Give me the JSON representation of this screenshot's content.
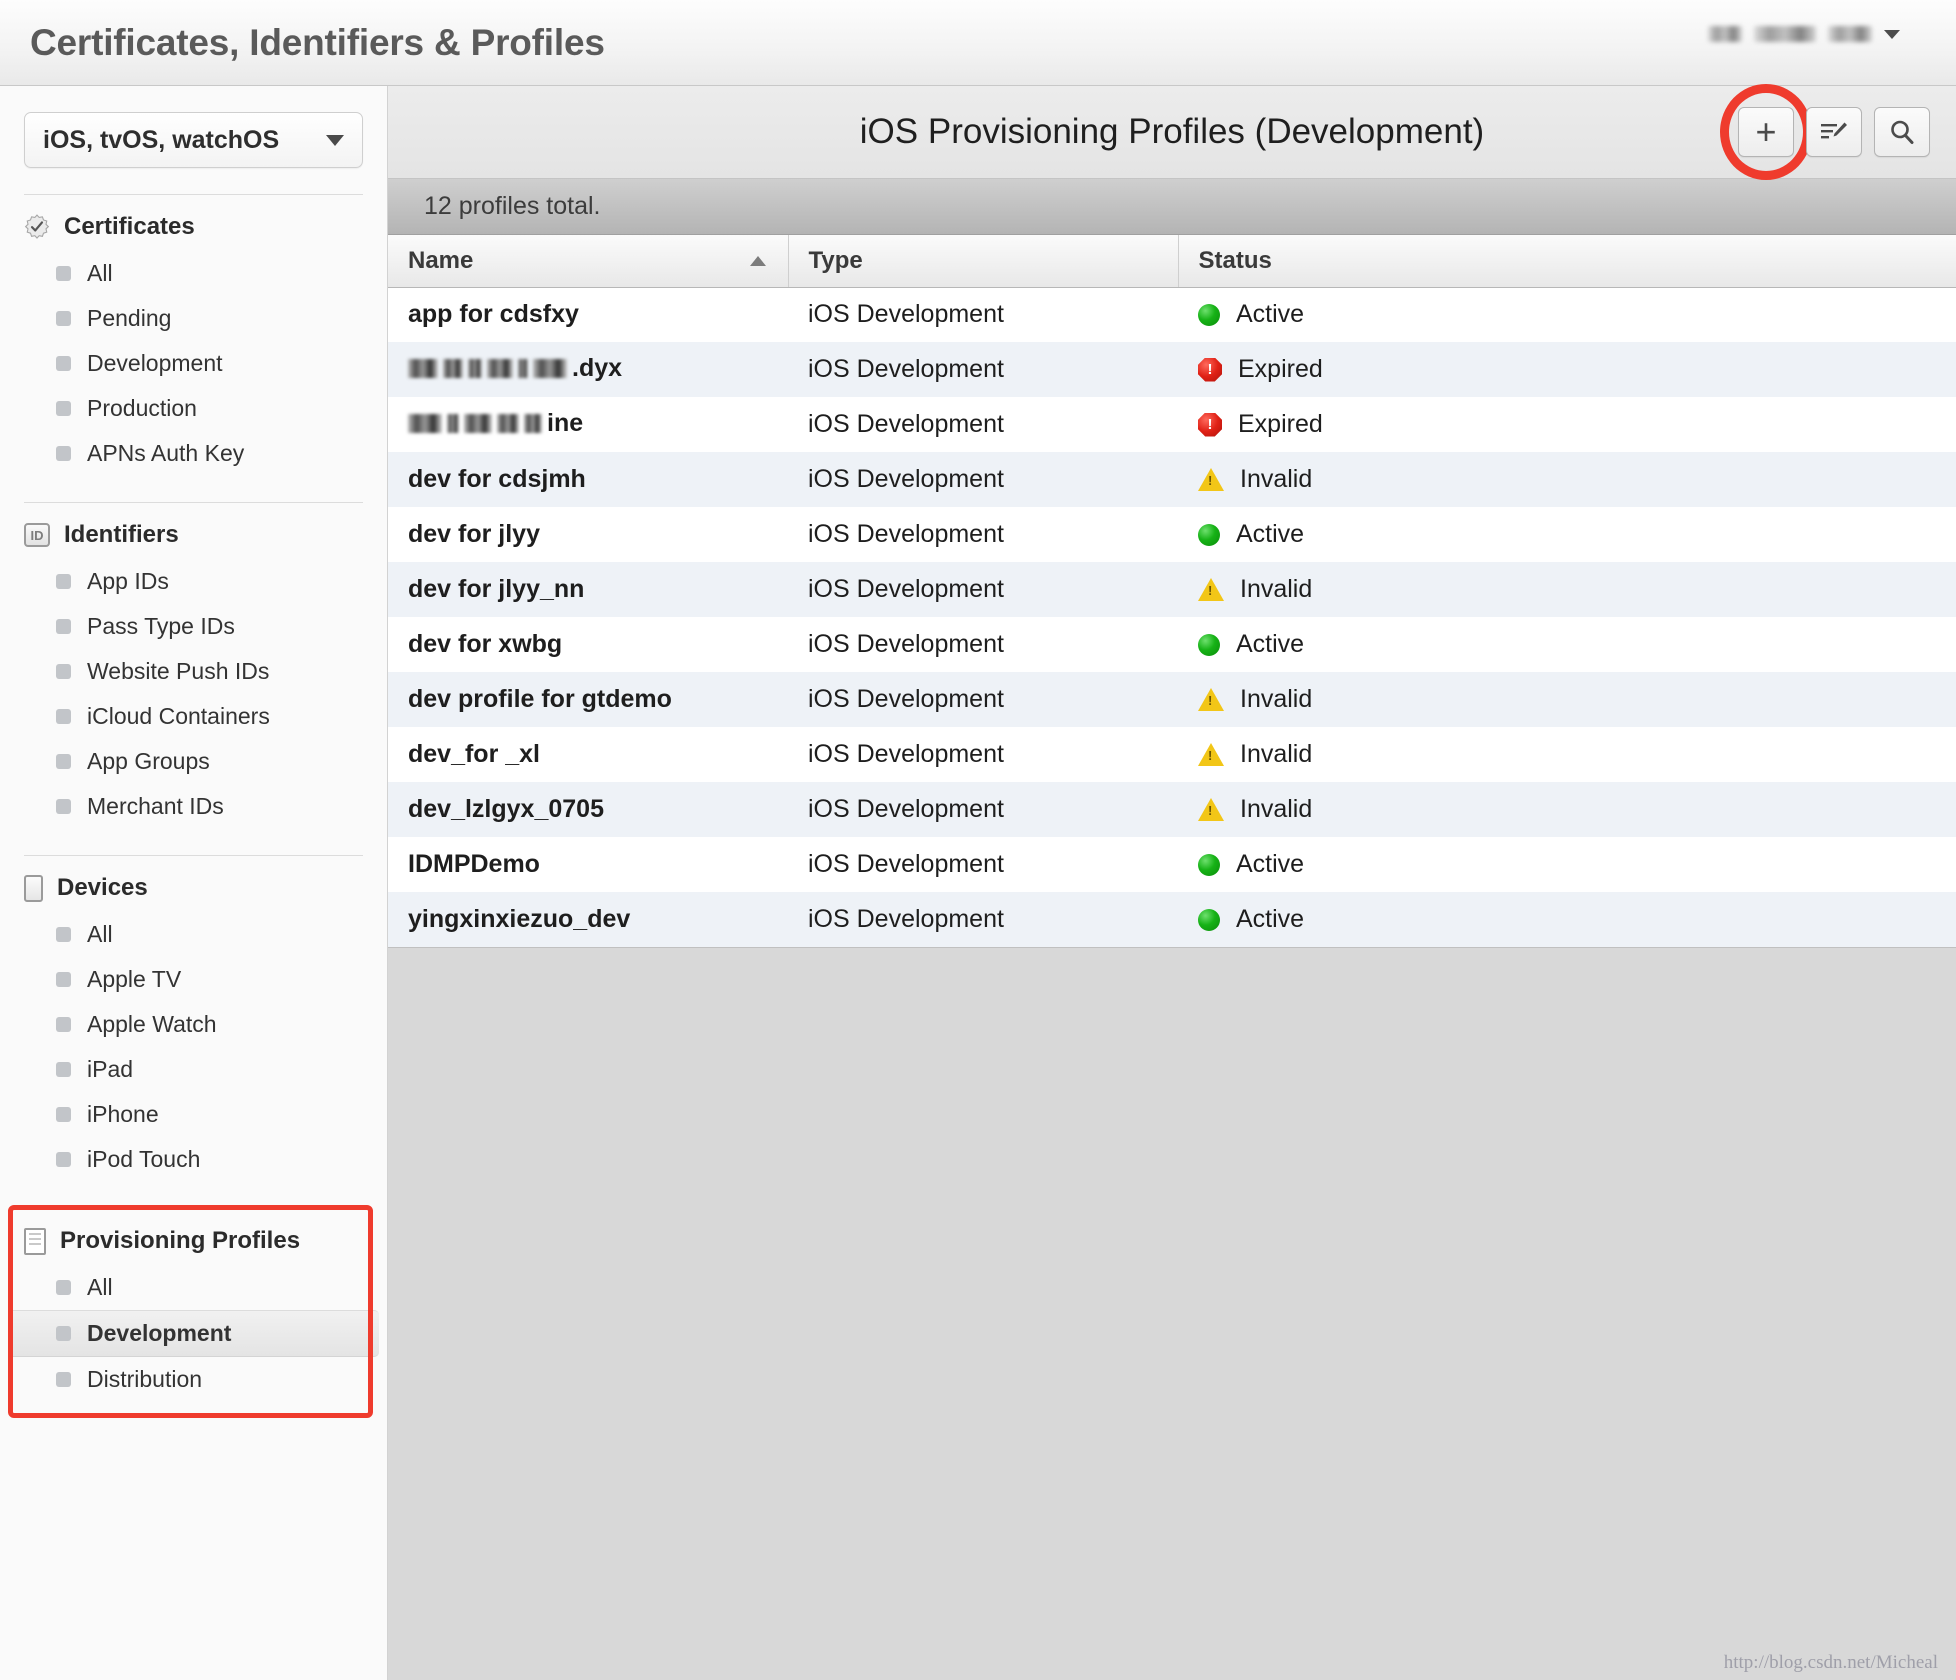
{
  "topbar": {
    "title": "Certificates, Identifiers & Profiles",
    "account_redacted": true,
    "caret_icon": "chevron-down-icon"
  },
  "sidebar": {
    "platform_select": {
      "value": "iOS, tvOS, watchOS",
      "caret_icon": "chevron-down-icon"
    },
    "groups": [
      {
        "label": "Certificates",
        "icon": "seal-check-icon",
        "items": [
          "All",
          "Pending",
          "Development",
          "Production",
          "APNs Auth Key"
        ]
      },
      {
        "label": "Identifiers",
        "icon": "id-badge-icon",
        "items": [
          "App IDs",
          "Pass Type IDs",
          "Website Push IDs",
          "iCloud Containers",
          "App Groups",
          "Merchant IDs"
        ]
      },
      {
        "label": "Devices",
        "icon": "device-icon",
        "items": [
          "All",
          "Apple TV",
          "Apple Watch",
          "iPad",
          "iPhone",
          "iPod Touch"
        ]
      },
      {
        "label": "Provisioning Profiles",
        "icon": "document-icon",
        "items": [
          "All",
          "Development",
          "Distribution"
        ],
        "selected": "Development",
        "highlighted": true
      }
    ]
  },
  "main": {
    "title": "iOS Provisioning Profiles (Development)",
    "actions": [
      {
        "name": "add-button",
        "icon": "plus-icon",
        "highlighted": true
      },
      {
        "name": "edit-button",
        "icon": "edit-list-icon",
        "highlighted": false
      },
      {
        "name": "search-button",
        "icon": "search-icon",
        "highlighted": false
      }
    ],
    "count_text": "12 profiles total.",
    "table": {
      "columns": [
        "Name",
        "Type",
        "Status"
      ],
      "sorted_by": "Name",
      "sort_direction": "ascending",
      "rows": [
        {
          "name": "app for cdsfxy",
          "redacted": false,
          "type": "iOS Development",
          "status": "Active",
          "status_icon": "status-active-icon"
        },
        {
          "name": ".dyx",
          "redacted": true,
          "type": "iOS Development",
          "status": "Expired",
          "status_icon": "status-expired-icon"
        },
        {
          "name": "ine",
          "redacted": true,
          "type": "iOS Development",
          "status": "Expired",
          "status_icon": "status-expired-icon"
        },
        {
          "name": "dev for cdsjmh",
          "redacted": false,
          "type": "iOS Development",
          "status": "Invalid",
          "status_icon": "status-invalid-icon"
        },
        {
          "name": "dev for jlyy",
          "redacted": false,
          "type": "iOS Development",
          "status": "Active",
          "status_icon": "status-active-icon"
        },
        {
          "name": "dev for jlyy_nn",
          "redacted": false,
          "type": "iOS Development",
          "status": "Invalid",
          "status_icon": "status-invalid-icon"
        },
        {
          "name": "dev for xwbg",
          "redacted": false,
          "type": "iOS Development",
          "status": "Active",
          "status_icon": "status-active-icon"
        },
        {
          "name": "dev profile for gtdemo",
          "redacted": false,
          "type": "iOS Development",
          "status": "Invalid",
          "status_icon": "status-invalid-icon"
        },
        {
          "name": "dev_for _xl",
          "redacted": false,
          "type": "iOS Development",
          "status": "Invalid",
          "status_icon": "status-invalid-icon"
        },
        {
          "name": "dev_lzlgyx_0705",
          "redacted": false,
          "type": "iOS Development",
          "status": "Invalid",
          "status_icon": "status-invalid-icon"
        },
        {
          "name": "IDMPDemo",
          "redacted": false,
          "type": "iOS Development",
          "status": "Active",
          "status_icon": "status-active-icon"
        },
        {
          "name": "yingxinxiezuo_dev",
          "redacted": false,
          "type": "iOS Development",
          "status": "Active",
          "status_icon": "status-active-icon"
        }
      ]
    },
    "watermark": "http://blog.csdn.net/Micheal"
  },
  "colors": {
    "highlight_red": "#ef3b2d",
    "status_active": "#16b216",
    "status_expired": "#e02116",
    "status_invalid": "#f2c617",
    "row_alt": "#eef2f7",
    "empty_area": "#d8d8d8"
  }
}
